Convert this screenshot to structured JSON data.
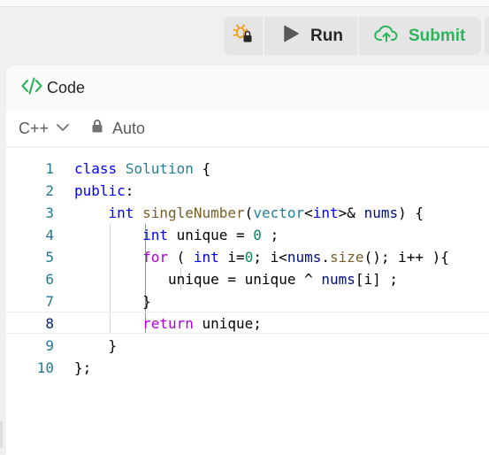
{
  "toolbar": {
    "run_label": "Run",
    "submit_label": "Submit"
  },
  "colors": {
    "keyword": "#0000ff",
    "type": "#267f99",
    "function": "#795e26",
    "control": "#af00db",
    "number": "#098658",
    "variable": "#001080",
    "line_number": "#237893",
    "submit_green": "#2db55d"
  },
  "panel": {
    "title": "Code",
    "language": "C++",
    "mode": "Auto",
    "icons": [
      "code-icon",
      "chevron-down-icon",
      "lock-icon"
    ]
  },
  "editor": {
    "active_line": 8,
    "lines": [
      {
        "num": "1",
        "text": "class Solution {"
      },
      {
        "num": "2",
        "text": "public:"
      },
      {
        "num": "3",
        "text": "    int singleNumber(vector<int>& nums) {"
      },
      {
        "num": "4",
        "text": "        int unique = 0 ;"
      },
      {
        "num": "5",
        "text": "        for ( int i=0; i<nums.size(); i++ ){"
      },
      {
        "num": "6",
        "text": "           unique = unique ^ nums[i] ;"
      },
      {
        "num": "7",
        "text": "        }"
      },
      {
        "num": "8",
        "text": "        return unique;"
      },
      {
        "num": "9",
        "text": "    }"
      },
      {
        "num": "10",
        "text": "};"
      }
    ]
  }
}
